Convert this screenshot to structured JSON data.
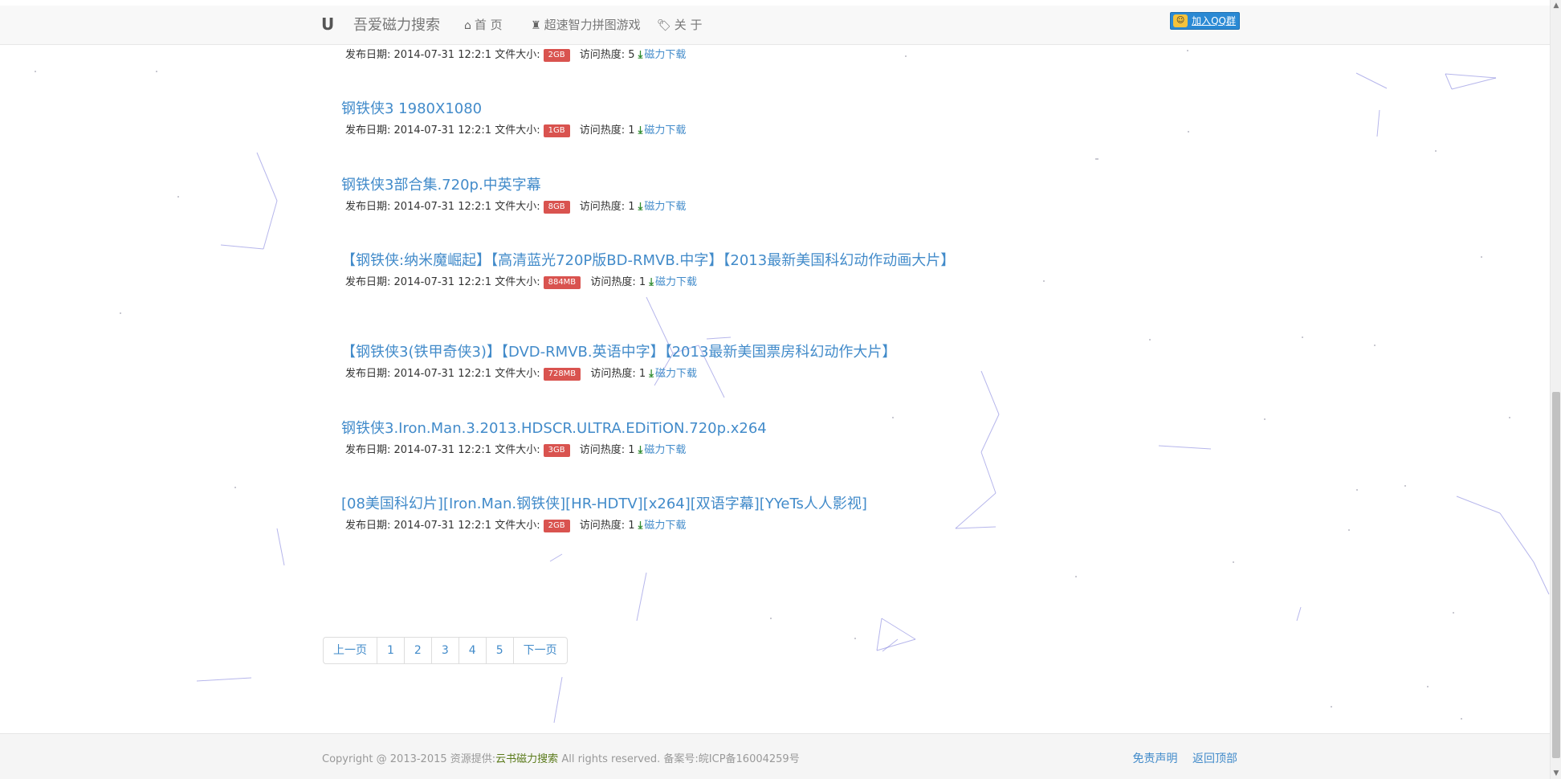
{
  "nav": {
    "brand_logo": "U",
    "brand": "吾爱磁力搜索",
    "items": [
      {
        "icon": "home-icon",
        "label": "首 页"
      },
      {
        "icon": "rook-icon",
        "label": "超速智力拼图游戏"
      },
      {
        "icon": "tags-icon",
        "label": "关 于"
      }
    ],
    "qq_button": "加入QQ群"
  },
  "meta_labels": {
    "date": "发布日期:",
    "size": "文件大小:",
    "heat": "访问热度:",
    "download": "磁力下载"
  },
  "results": [
    {
      "title": "",
      "date": "2014-07-31 12:2:1",
      "size": "2GB",
      "heat": "5"
    },
    {
      "title": "钢铁侠3 1980X1080",
      "date": "2014-07-31 12:2:1",
      "size": "1GB",
      "heat": "1"
    },
    {
      "title": "钢铁侠3部合集.720p.中英字幕",
      "date": "2014-07-31 12:2:1",
      "size": "8GB",
      "heat": "1"
    },
    {
      "title": "【钢铁侠:纳米魔崛起】【高清蓝光720P版BD-RMVB.中字】【2013最新美国科幻动作动画大片】",
      "date": "2014-07-31 12:2:1",
      "size": "884MB",
      "heat": "1"
    },
    {
      "title": "【钢铁侠3(铁甲奇侠3)】【DVD-RMVB.英语中字】【2013最新美国票房科幻动作大片】",
      "date": "2014-07-31 12:2:1",
      "size": "728MB",
      "heat": "1"
    },
    {
      "title": "钢铁侠3.Iron.Man.3.2013.HDSCR.ULTRA.EDiTiON.720p.x264",
      "date": "2014-07-31 12:2:1",
      "size": "3GB",
      "heat": "1"
    },
    {
      "title": "[08美国科幻片][Iron.Man.钢铁侠][HR-HDTV][x264][双语字幕][YYeTs人人影视]",
      "date": "2014-07-31 12:2:1",
      "size": "2GB",
      "heat": "1"
    }
  ],
  "pagination": {
    "prev": "上一页",
    "pages": [
      "1",
      "2",
      "3",
      "4",
      "5"
    ],
    "next": "下一页"
  },
  "footer": {
    "copyright_prefix": "Copyright @ 2013-2015 资源提供:",
    "source": "云书磁力搜索",
    "copyright_suffix": " All rights reserved. 备案号:皖ICP备16004259号",
    "links": [
      "免责声明",
      "返回顶部"
    ]
  },
  "colors": {
    "link": "#428bca",
    "badge": "#d9534f",
    "download_icon": "#2e8b2e",
    "navbar_bg": "#f8f8f8",
    "footer_bg": "#f5f5f5",
    "background_lines": "#7b7bdc"
  }
}
